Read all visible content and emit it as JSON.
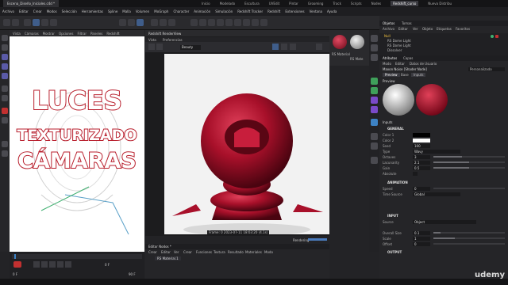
{
  "titlebar": {
    "doc_tab": "Escena_Diseño_Iniciales.c4d *",
    "layouts": [
      "Inicio",
      "Modelado",
      "Escultura",
      "UVEdit",
      "Pintar",
      "Grooming",
      "Track",
      "Scripts",
      "Nodes",
      "Redshift_curso",
      "Nueva Distribu"
    ],
    "active_layout": "Redshift_curso"
  },
  "menubar": {
    "items": [
      "Archivo",
      "Editar",
      "Crear",
      "Modos",
      "Selección",
      "Herramientas",
      "Spline",
      "Malla",
      "Volumen",
      "MoGraph",
      "Character",
      "Animación",
      "Simulación",
      "Redshift Tracker",
      "Redshift",
      "Extensiones",
      "Ventana",
      "Ayuda"
    ]
  },
  "viewport_left": {
    "menu": [
      "Vista",
      "Cámaras",
      "Mostrar",
      "Opciones",
      "Filtrar",
      "Paneles",
      "Redshift"
    ],
    "overlay_lines": [
      "LUCES",
      "TEXTURIZADO",
      "CÁMARAS"
    ]
  },
  "render_view": {
    "title": "Redshift RenderView",
    "menu": [
      "Vista",
      "Preferencias"
    ],
    "mode": "Beauty",
    "frame_info": "Frame: 0  2023-07-11  18:03:20  (4.1s)",
    "status_label": "Rendering",
    "accent_color": "#b3122a"
  },
  "materials": {
    "label1": "RS Material",
    "label2": "RS Mate"
  },
  "objects": {
    "tabs": [
      "Objetos",
      "Tomas"
    ],
    "menu": [
      "Archivo",
      "Editar",
      "Ver",
      "Objeto",
      "Etiquetas",
      "Favoritos"
    ],
    "items": [
      "Null",
      "RS Dome Light",
      "RS Dome Light",
      "Dissolver"
    ]
  },
  "attributes": {
    "tabs": [
      "Atributos",
      "Capas"
    ],
    "menu": [
      "Modo",
      "Editar",
      "Datos de Usuario"
    ],
    "node_name": "Maxon Noise [Shader Node]",
    "preset": "Personalizado",
    "subtabs": [
      "Preview",
      "Base",
      "Inputs"
    ],
    "preview_label": "Preview",
    "inputs_label": "Inputs",
    "sections": {
      "general": "GENERAL",
      "animation": "ANIMATION",
      "input": "INPUT",
      "output": "OUTPUT"
    },
    "props": [
      {
        "label": "Color 1",
        "value": ""
      },
      {
        "label": "Color 2",
        "value": ""
      },
      {
        "label": "Seed",
        "value": "100"
      },
      {
        "label": "Type",
        "value": "Wavy"
      },
      {
        "label": "Octaves",
        "value": "3"
      },
      {
        "label": "Lacunarity",
        "value": "2.1"
      },
      {
        "label": "Gain",
        "value": "0.5"
      },
      {
        "label": "Absolute",
        "value": ""
      },
      {
        "label": "Speed",
        "value": "0"
      },
      {
        "label": "Time Source",
        "value": "Global"
      },
      {
        "label": "Source",
        "value": "Object"
      },
      {
        "label": "Overall Size",
        "value": "0.1"
      },
      {
        "label": "Scale",
        "value": "1"
      },
      {
        "label": "Offset",
        "value": "0"
      }
    ]
  },
  "bottom_panel": {
    "title": "Editor Nodos *",
    "menu": [
      "Crear",
      "Editar",
      "Ver",
      "Crear",
      "Funciones",
      "Textura",
      "Resultado",
      "Materiales",
      "Modo"
    ],
    "material": "RS Material.1"
  },
  "timeline": {
    "start": "0 F",
    "end": "90 F",
    "current": "0 F"
  },
  "watermark": "udemy"
}
